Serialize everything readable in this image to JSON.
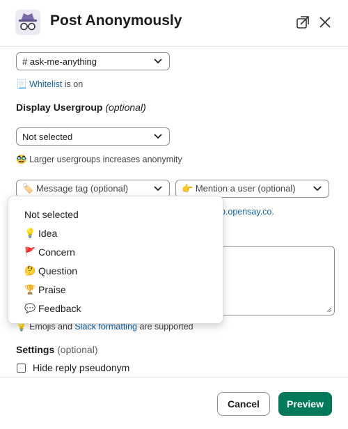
{
  "header": {
    "title": "Post Anonymously"
  },
  "channel_select": {
    "value": "# ask-me-anything"
  },
  "whitelist": {
    "emoji": "📃",
    "link": "Whitelist",
    "suffix": " is on"
  },
  "usergroup": {
    "heading": "Display Usergroup",
    "optional": "(optional)",
    "select_value": "Not selected",
    "hint_emoji": "🥸",
    "hint_text": "Larger usergroups increases anonymity"
  },
  "message_tag": {
    "emoji": "🏷️",
    "placeholder": "Message tag (optional)"
  },
  "mention": {
    "emoji": "👉",
    "placeholder": "Mention a user (optional)"
  },
  "partial_link": "pp.opensay.co.",
  "format_hint": {
    "emoji": "💡",
    "prefix": "Emojis and ",
    "link": "Slack formatting",
    "suffix": " are supported"
  },
  "settings": {
    "heading": "Settings",
    "optional": "(optional)",
    "hide_reply": "Hide reply pseudonym"
  },
  "footer": {
    "cancel": "Cancel",
    "preview": "Preview"
  },
  "menu": {
    "items": [
      {
        "emoji": "",
        "label": "Not selected"
      },
      {
        "emoji": "💡",
        "label": "Idea"
      },
      {
        "emoji": "🚩",
        "label": "Concern"
      },
      {
        "emoji": "🤔",
        "label": "Question"
      },
      {
        "emoji": "🏆",
        "label": "Praise"
      },
      {
        "emoji": "💬",
        "label": "Feedback"
      }
    ]
  },
  "colors": {
    "accent": "#007a5a",
    "link": "#1264a3"
  }
}
